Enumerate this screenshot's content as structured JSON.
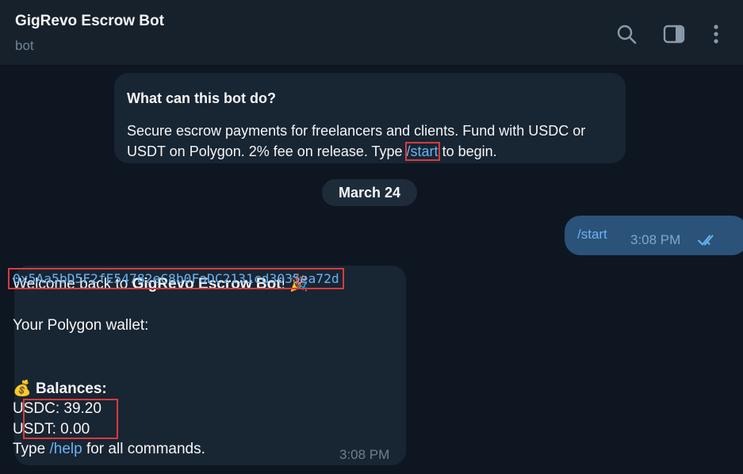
{
  "header": {
    "title": "GigRevo Escrow Bot",
    "subtitle": "bot",
    "icons": [
      "search-icon",
      "sidebar-panel-icon",
      "more-vertical-icon"
    ]
  },
  "info_card": {
    "title": "What can this bot do?",
    "text_part1": "Secure escrow payments for freelancers and clients. Fund with USDC or USDT on Polygon. 2% fee on release. Type ",
    "command": "/start",
    "text_part2": " to begin."
  },
  "date_divider": "March 24",
  "outgoing_message": {
    "text": "/start",
    "time": "3:08 PM",
    "status": "read"
  },
  "incoming_message": {
    "welcome_prefix": "Welcome back to ",
    "bot_name": "GigRevo Escrow Bot",
    "welcome_suffix": "!",
    "party_emoji": "🎉",
    "wallet_label": "Your Polygon wallet:",
    "wallet_address": "0x5Aa5bD5F2fE54782eC8b0FaDC2131cd3035ea72d",
    "balances_emoji": "💰",
    "balances_title": "Balances:",
    "usdc": "USDC: 39.20",
    "usdt": "USDT: 0.00",
    "help_prefix": "Type ",
    "help_command": "/help",
    "help_suffix": " for all commands.",
    "time": "3:08 PM"
  },
  "colors": {
    "background": "#0e1621",
    "header": "#17212b",
    "incoming_bubble": "#182533",
    "outgoing_bubble": "#2b5278",
    "link": "#6ab3f3",
    "highlight_box": "#d63c3c"
  }
}
